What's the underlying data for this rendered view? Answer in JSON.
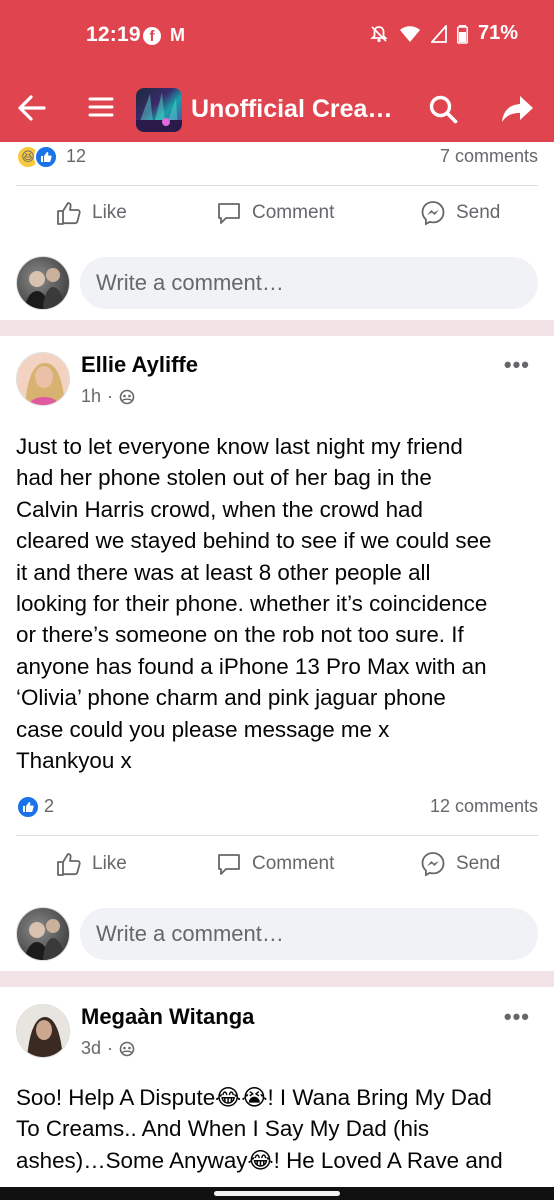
{
  "status_bar": {
    "time": "12:19",
    "battery": "71%"
  },
  "header": {
    "title": "Unofficial Cream…"
  },
  "posts": [
    {
      "reactions_count": "12",
      "comments_count": "7 comments",
      "actions": {
        "like": "Like",
        "comment": "Comment",
        "send": "Send"
      },
      "comment_placeholder": "Write a comment…"
    },
    {
      "author": "Ellie Ayliffe",
      "time": "1h",
      "lines": [
        "Just to let everyone know last night my friend",
        "had her phone stolen out of her bag in the",
        "Calvin Harris crowd, when the crowd had",
        "cleared we stayed behind to see if we could see",
        "it and there was at least 8 other people all",
        "looking for their phone. whether it’s coincidence",
        "or there’s someone on the rob not too sure. If",
        "anyone has found a iPhone 13 Pro Max with an",
        "‘Olivia’ phone charm and pink jaguar phone",
        "case could you please message me x",
        "Thankyou x"
      ],
      "reactions_count": "2",
      "comments_count": "12 comments",
      "actions": {
        "like": "Like",
        "comment": "Comment",
        "send": "Send"
      },
      "comment_placeholder": "Write a comment…"
    },
    {
      "author": "Megaàn Witanga",
      "time": "3d",
      "lines": [
        "Soo! Help A Dispute😂😭! I Wana Bring My Dad",
        "To Creams.. And When I Say My Dad (his",
        "ashes)…Some Anyway😂! He Loved A Rave and"
      ]
    }
  ],
  "colors": {
    "header_bg": "#e0454f",
    "separator": "#f2e4e6",
    "like_blue": "#1a73e8"
  }
}
